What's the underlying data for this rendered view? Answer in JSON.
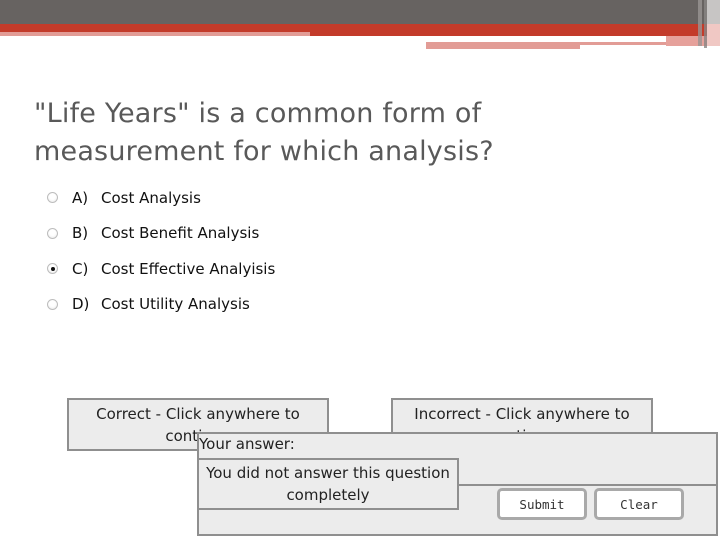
{
  "question": {
    "text": "\"Life Years\" is a common form of measurement for which analysis?"
  },
  "options": [
    {
      "letter": "A)",
      "label": "Cost Analysis",
      "selected": false
    },
    {
      "letter": "B)",
      "label": "Cost Benefit Analysis",
      "selected": false
    },
    {
      "letter": "C)",
      "label": "Cost Effective Analyisis",
      "selected": true
    },
    {
      "letter": "D)",
      "label": "Cost Utility Analysis",
      "selected": false
    }
  ],
  "feedback": {
    "correct": "Correct - Click anywhere to continue",
    "incorrect": "Incorrect - Click anywhere to continue"
  },
  "answer_panel": {
    "label": "Your answer:",
    "message": "You did not answer this question completely",
    "submit_label": "Submit",
    "clear_label": "Clear"
  },
  "theme": {
    "header_dark": "#676361",
    "header_accent": "#c33b2a",
    "accent_light": "#e29c96",
    "panel_bg": "#ececec",
    "panel_border": "#8f8f8f"
  }
}
